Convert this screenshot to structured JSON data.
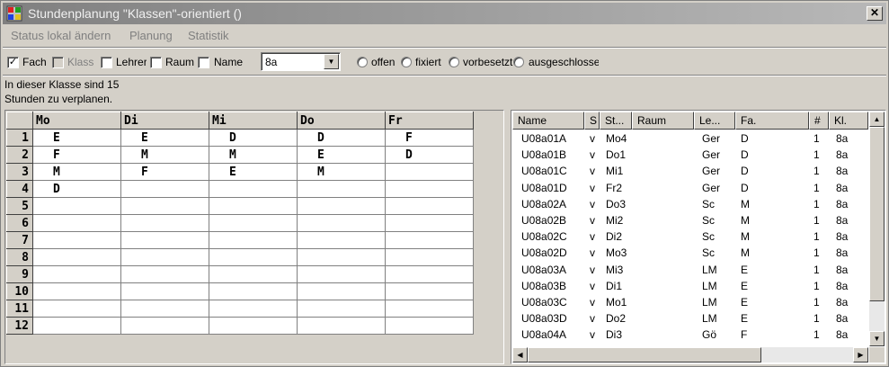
{
  "window": {
    "title": "Stundenplanung \"Klassen\"-orientiert ()",
    "close_label": "✕"
  },
  "menu": {
    "items": [
      "Status lokal ändern",
      "Planung",
      "Statistik"
    ]
  },
  "toolbar": {
    "checkboxes": [
      {
        "label": "Fach",
        "checked": true,
        "enabled": true
      },
      {
        "label": "Klass",
        "checked": false,
        "enabled": false
      },
      {
        "label": "Lehrer",
        "checked": false,
        "enabled": true
      },
      {
        "label": "Raum",
        "checked": false,
        "enabled": true
      },
      {
        "label": "Name",
        "checked": false,
        "enabled": true
      }
    ],
    "class_select": {
      "value": "8a"
    },
    "radios": [
      {
        "label": "offen"
      },
      {
        "label": "fixiert"
      },
      {
        "label": "vorbesetzt"
      },
      {
        "label": "ausgeschlossen"
      }
    ]
  },
  "info": {
    "line1": "In dieser Klasse sind 15",
    "line2": "Stunden zu verplanen."
  },
  "schedule": {
    "days": [
      "Mo",
      "Di",
      "Mi",
      "Do",
      "Fr"
    ],
    "rows": [
      {
        "num": "1",
        "cells": [
          "E",
          "E",
          "D",
          "D",
          "F"
        ]
      },
      {
        "num": "2",
        "cells": [
          "F",
          "M",
          "M",
          "E",
          "D"
        ]
      },
      {
        "num": "3",
        "cells": [
          "M",
          "F",
          "E",
          "M",
          ""
        ]
      },
      {
        "num": "4",
        "cells": [
          "D",
          "",
          "",
          "",
          ""
        ]
      },
      {
        "num": "5",
        "cells": [
          "",
          "",
          "",
          "",
          ""
        ]
      },
      {
        "num": "6",
        "cells": [
          "",
          "",
          "",
          "",
          ""
        ]
      },
      {
        "num": "7",
        "cells": [
          "",
          "",
          "",
          "",
          ""
        ]
      },
      {
        "num": "8",
        "cells": [
          "",
          "",
          "",
          "",
          ""
        ]
      },
      {
        "num": "9",
        "cells": [
          "",
          "",
          "",
          "",
          ""
        ]
      },
      {
        "num": "10",
        "cells": [
          "",
          "",
          "",
          "",
          ""
        ]
      },
      {
        "num": "11",
        "cells": [
          "",
          "",
          "",
          "",
          ""
        ]
      },
      {
        "num": "12",
        "cells": [
          "",
          "",
          "",
          "",
          ""
        ]
      }
    ]
  },
  "list": {
    "columns": [
      "Name",
      "S",
      "St...",
      "Raum",
      "Le...",
      "Fa.",
      "#",
      "Kl."
    ],
    "rows": [
      [
        "U08a01A",
        "v",
        "Mo4",
        "",
        "Ger",
        "D",
        "1",
        "8a"
      ],
      [
        "U08a01B",
        "v",
        "Do1",
        "",
        "Ger",
        "D",
        "1",
        "8a"
      ],
      [
        "U08a01C",
        "v",
        "Mi1",
        "",
        "Ger",
        "D",
        "1",
        "8a"
      ],
      [
        "U08a01D",
        "v",
        "Fr2",
        "",
        "Ger",
        "D",
        "1",
        "8a"
      ],
      [
        "U08a02A",
        "v",
        "Do3",
        "",
        "Sc",
        "M",
        "1",
        "8a"
      ],
      [
        "U08a02B",
        "v",
        "Mi2",
        "",
        "Sc",
        "M",
        "1",
        "8a"
      ],
      [
        "U08a02C",
        "v",
        "Di2",
        "",
        "Sc",
        "M",
        "1",
        "8a"
      ],
      [
        "U08a02D",
        "v",
        "Mo3",
        "",
        "Sc",
        "M",
        "1",
        "8a"
      ],
      [
        "U08a03A",
        "v",
        "Mi3",
        "",
        "LM",
        "E",
        "1",
        "8a"
      ],
      [
        "U08a03B",
        "v",
        "Di1",
        "",
        "LM",
        "E",
        "1",
        "8a"
      ],
      [
        "U08a03C",
        "v",
        "Mo1",
        "",
        "LM",
        "E",
        "1",
        "8a"
      ],
      [
        "U08a03D",
        "v",
        "Do2",
        "",
        "LM",
        "E",
        "1",
        "8a"
      ],
      [
        "U08a04A",
        "v",
        "Di3",
        "",
        "Gö",
        "F",
        "1",
        "8a"
      ]
    ]
  }
}
